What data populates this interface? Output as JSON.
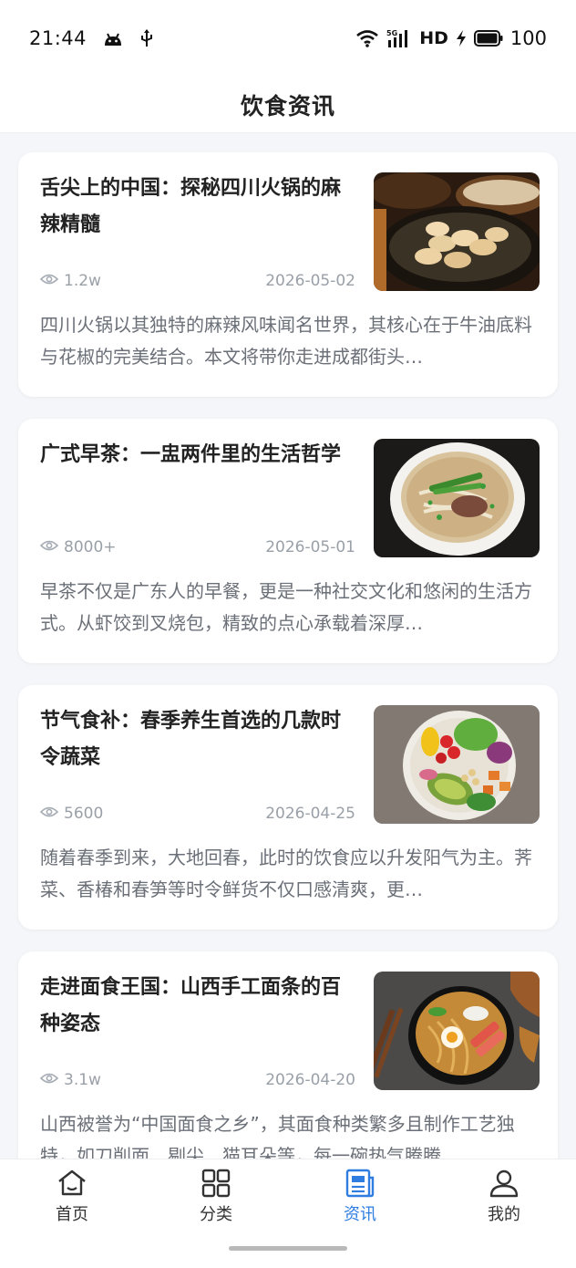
{
  "status_bar": {
    "time": "21:44",
    "network": "HD",
    "battery": "100",
    "icons": [
      "android-icon",
      "usb-icon",
      "wifi-icon",
      "5g-signal-icon",
      "charging-icon",
      "battery-icon"
    ]
  },
  "header": {
    "title": "饮食资讯"
  },
  "articles": [
    {
      "title": "舌尖上的中国：探秘四川火锅的麻辣精髓",
      "views": "1.2w",
      "date": "2026-05-02",
      "summary": "四川火锅以其独特的麻辣风味闻名世界，其核心在于牛油底料与花椒的完美结合。本文将带你走进成都街头…",
      "image": "dumplings-steamer-photo"
    },
    {
      "title": "广式早茶：一盅两件里的生活哲学",
      "views": "8000+",
      "date": "2026-05-01",
      "summary": "早茶不仅是广东人的早餐，更是一种社交文化和悠闲的生活方式。从虾饺到叉烧包，精致的点心承载着深厚…",
      "image": "beef-noodle-soup-photo"
    },
    {
      "title": "节气食补：春季养生首选的几款时令蔬菜",
      "views": "5600",
      "date": "2026-04-25",
      "summary": "随着春季到来，大地回春，此时的饮食应以升发阳气为主。荠菜、香椿和春笋等时令鲜货不仅口感清爽，更…",
      "image": "vegetable-salad-bowl-photo"
    },
    {
      "title": "走进面食王国：山西手工面条的百种姿态",
      "views": "3.1w",
      "date": "2026-04-20",
      "summary": "山西被誉为“中国面食之乡”，其面食种类繁多且制作工艺独特，如刀削面、剔尖、猫耳朵等，每一碗热气腾腾…",
      "image": "ramen-bowl-photo"
    }
  ],
  "bottom_nav": {
    "active_color": "#2f7de1",
    "items": [
      {
        "label": "首页",
        "icon": "home-icon",
        "active": false
      },
      {
        "label": "分类",
        "icon": "grid-icon",
        "active": false
      },
      {
        "label": "资讯",
        "icon": "news-icon",
        "active": true
      },
      {
        "label": "我的",
        "icon": "user-icon",
        "active": false
      }
    ]
  }
}
